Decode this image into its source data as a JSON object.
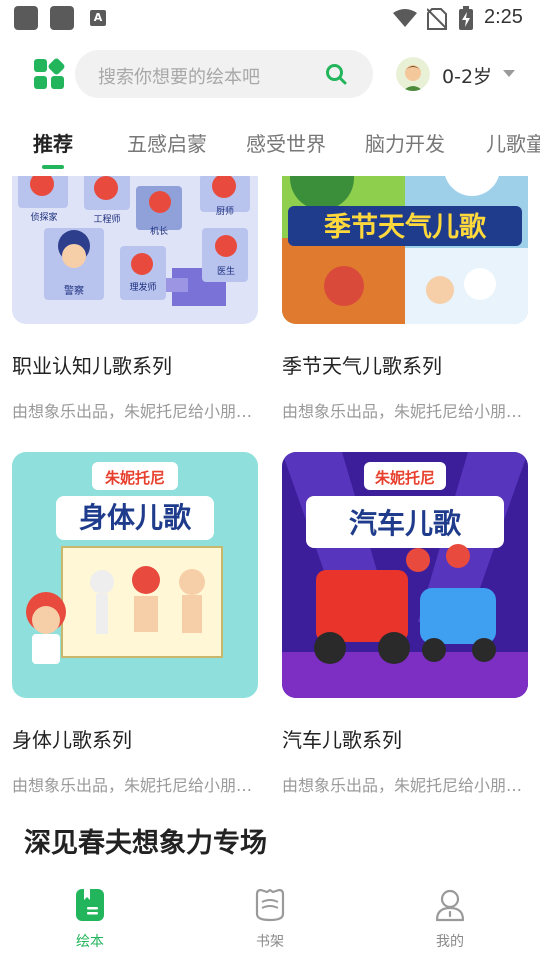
{
  "status_bar": {
    "time": "2:25",
    "icons": [
      "app-notification-icon",
      "app-notification-icon",
      "a-icon",
      "wifi-icon",
      "no-sim-icon",
      "battery-charging-icon"
    ]
  },
  "header": {
    "menu_icon": "grid-icon",
    "search_placeholder": "搜索你想要的绘本吧",
    "search_icon": "search-icon",
    "avatar_icon": "child-avatar",
    "age_label": "0-2岁"
  },
  "tabs": [
    {
      "label": "推荐",
      "active": true
    },
    {
      "label": "五感启蒙",
      "active": false
    },
    {
      "label": "感受世界",
      "active": false
    },
    {
      "label": "脑力开发",
      "active": false
    },
    {
      "label": "儿歌童谣",
      "active": false
    }
  ],
  "cards": [
    {
      "title": "职业认知儿歌系列",
      "subtitle": "由想象乐出品，朱妮托尼给小朋友们带来的职业认知儿歌",
      "image_labels": [
        "侦探家",
        "工程师",
        "机长",
        "厨师",
        "警察",
        "理发师",
        "医生"
      ]
    },
    {
      "title": "季节天气儿歌系列",
      "subtitle": "由想象乐出品，朱妮托尼给小朋友们带来的季节天气儿歌",
      "image_labels": [
        "季节天气儿歌"
      ]
    },
    {
      "title": "身体儿歌系列",
      "subtitle": "由想象乐出品，朱妮托尼给小朋友们带来的身体儿歌",
      "image_labels": [
        "朱妮托尼",
        "身体儿歌"
      ]
    },
    {
      "title": "汽车儿歌系列",
      "subtitle": "由想象乐出品，朱妮托尼给小朋友们带来的汽车儿歌",
      "image_labels": [
        "朱妮托尼",
        "汽车儿歌"
      ]
    }
  ],
  "section_title": "深见春夫想象力专场",
  "bottom_nav": [
    {
      "label": "绘本",
      "icon": "picture-book-icon",
      "active": true
    },
    {
      "label": "书架",
      "icon": "bookshelf-icon",
      "active": false
    },
    {
      "label": "我的",
      "icon": "profile-icon",
      "active": false
    }
  ],
  "colors": {
    "accent": "#22b55c",
    "text_primary": "#222222",
    "text_secondary": "#9a9a9a"
  }
}
